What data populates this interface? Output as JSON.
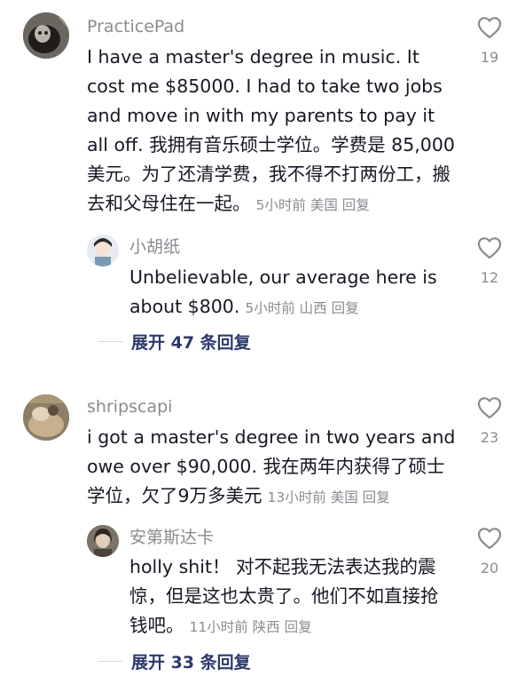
{
  "comments": [
    {
      "username": "PracticePad",
      "text": "I have a master's degree in music. It cost me $85000. I had to take two jobs and move in with my parents to pay it all off. 我拥有音乐硕士学位。学费是 85,000 美元。为了还清学费，我不得不打两份工，搬去和父母住在一起。",
      "time": "5小时前",
      "location": "美国",
      "reply": "回复",
      "likes": "19",
      "replies": [
        {
          "username": "小胡纸",
          "text": "Unbelievable, our average here is about $800.",
          "time": "5小时前",
          "location": "山西",
          "reply": "回复",
          "likes": "12"
        }
      ],
      "expand_label": "展开 47 条回复"
    },
    {
      "username": "shripscapi",
      "text": "i got a master's degree in two years and owe over $90,000. 我在两年内获得了硕士学位，欠了9万多美元",
      "time": "13小时前",
      "location": "美国",
      "reply": "回复",
      "likes": "23",
      "replies": [
        {
          "username": "安第斯达卡",
          "text": "holly shit！ 对不起我无法表达我的震惊，但是这也太贵了。他们不如直接抢钱吧。",
          "time": "11小时前",
          "location": "陕西",
          "reply": "回复",
          "likes": "20"
        }
      ],
      "expand_label": "展开 33 条回复"
    }
  ],
  "icons": {
    "like": "heart-outline-icon"
  },
  "colors": {
    "username": "#8a8b91",
    "text": "#161823",
    "expand": "#2b3a6b"
  }
}
